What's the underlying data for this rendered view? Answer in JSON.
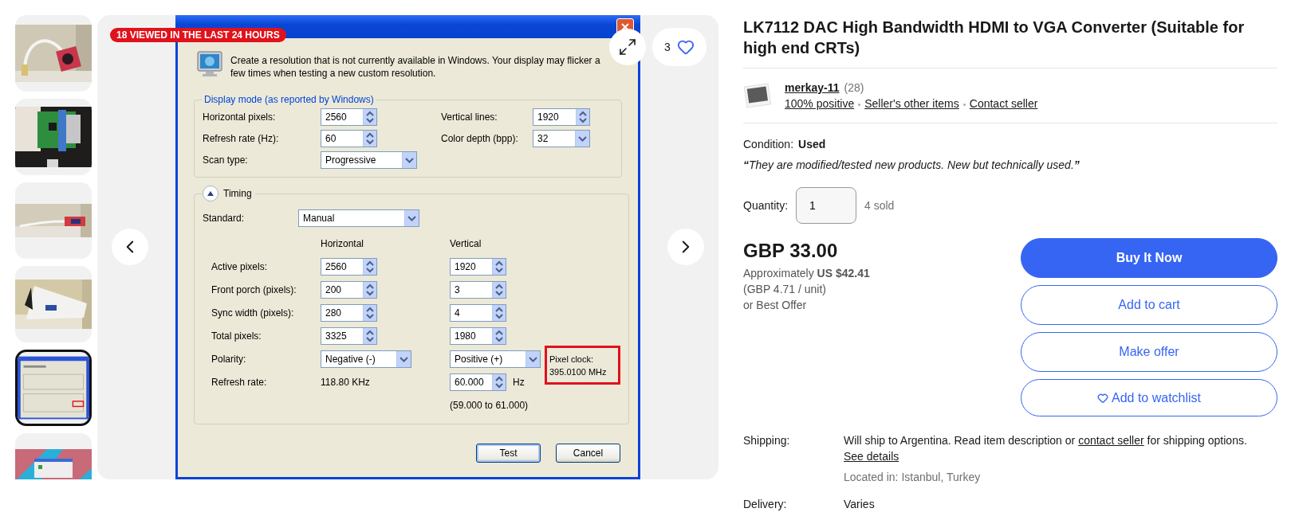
{
  "gallery": {
    "thumbnails": [
      {
        "selected": false
      },
      {
        "selected": false
      },
      {
        "selected": false
      },
      {
        "selected": false
      },
      {
        "selected": true
      },
      {
        "selected": false
      }
    ],
    "badge": "18 VIEWED IN THE LAST 24 HOURS",
    "watch_count": "3",
    "dialog": {
      "description": "Create a resolution that is not currently available in Windows. Your display may flicker a few times when testing a new custom resolution.",
      "display_mode": {
        "title": "Display mode (as reported by Windows)",
        "rows": [
          {
            "left": {
              "label": "Horizontal pixels:",
              "value": "2560",
              "kind": "spinner"
            },
            "right": {
              "label": "Vertical lines:",
              "value": "1920",
              "kind": "spinner"
            }
          },
          {
            "left": {
              "label": "Refresh rate (Hz):",
              "value": "60",
              "kind": "spinner"
            },
            "right": {
              "label": "Color depth (bpp):",
              "value": "32",
              "kind": "dropdown"
            }
          },
          {
            "left": {
              "label": "Scan type:",
              "value": "Progressive",
              "kind": "dropdown"
            }
          }
        ]
      },
      "timing": {
        "title": "Timing",
        "expanded": true,
        "standard": {
          "label": "Standard:",
          "value": "Manual"
        },
        "columns": [
          "Horizontal",
          "Vertical"
        ],
        "rows": [
          {
            "label": "Active pixels:",
            "horizontal": {
              "kind": "spinner",
              "value": "2560"
            },
            "vertical": {
              "kind": "spinner",
              "value": "1920"
            }
          },
          {
            "label": "Front porch (pixels):",
            "horizontal": {
              "kind": "spinner",
              "value": "200"
            },
            "vertical": {
              "kind": "spinner",
              "value": "3"
            }
          },
          {
            "label": "Sync width (pixels):",
            "horizontal": {
              "kind": "spinner",
              "value": "280"
            },
            "vertical": {
              "kind": "spinner",
              "value": "4"
            }
          },
          {
            "label": "Total pixels:",
            "horizontal": {
              "kind": "spinner",
              "value": "3325"
            },
            "vertical": {
              "kind": "spinner",
              "value": "1980"
            }
          },
          {
            "label": "Polarity:",
            "horizontal": {
              "kind": "dropdown",
              "value": "Negative (-)"
            },
            "vertical": {
              "kind": "dropdown",
              "value": "Positive (+)"
            }
          },
          {
            "label": "Refresh rate:",
            "horizontal": {
              "kind": "text",
              "value": "118.80 KHz"
            },
            "vertical": {
              "kind": "spinner",
              "value": "60.000",
              "unit": "Hz"
            }
          }
        ],
        "range": "(59.000 to 61.000)",
        "pixel_clock": {
          "label": "Pixel clock:",
          "value": "395.0100 MHz"
        }
      },
      "buttons": [
        {
          "label": "Test",
          "default": true
        },
        {
          "label": "Cancel",
          "default": false
        }
      ]
    }
  },
  "listing": {
    "title": "LK7112 DAC High Bandwidth HDMI to VGA Converter (Suitable for high end CRTs)",
    "seller": {
      "name": "merkay-11",
      "feedback": "(28)",
      "links": [
        "100% positive",
        "Seller's other items",
        "Contact seller"
      ]
    },
    "condition": {
      "label": "Condition:",
      "value": "Used",
      "note": "**“**They are modified/tested new products. New but technically used.**”**"
    },
    "quantity": {
      "label": "Quantity:",
      "value": "1",
      "sold": "4 sold"
    },
    "price": {
      "amount": "GBP 33.00",
      "approx": "Approximately **US $42.41**",
      "unit": "(GBP 4.71 / unit)",
      "offer": "or Best Offer"
    },
    "actions": [
      {
        "label": "Buy It Now",
        "kind": "primary"
      },
      {
        "label": "Add to cart",
        "kind": "secondary"
      },
      {
        "label": "Make offer",
        "kind": "secondary"
      },
      {
        "label": "Add to watchlist",
        "kind": "watch"
      }
    ],
    "shipping": {
      "label": "Shipping:",
      "segments": [
        {
          "text": "Will ship to Argentina. Read item description or ",
          "link": false
        },
        {
          "text": "contact seller",
          "link": true
        },
        {
          "text": " for shipping options. ",
          "link": false
        },
        {
          "text": "See details",
          "link": true
        }
      ],
      "location": "Located in: Istanbul, Turkey"
    },
    "delivery": {
      "label": "Delivery:",
      "value": "Varies"
    }
  }
}
